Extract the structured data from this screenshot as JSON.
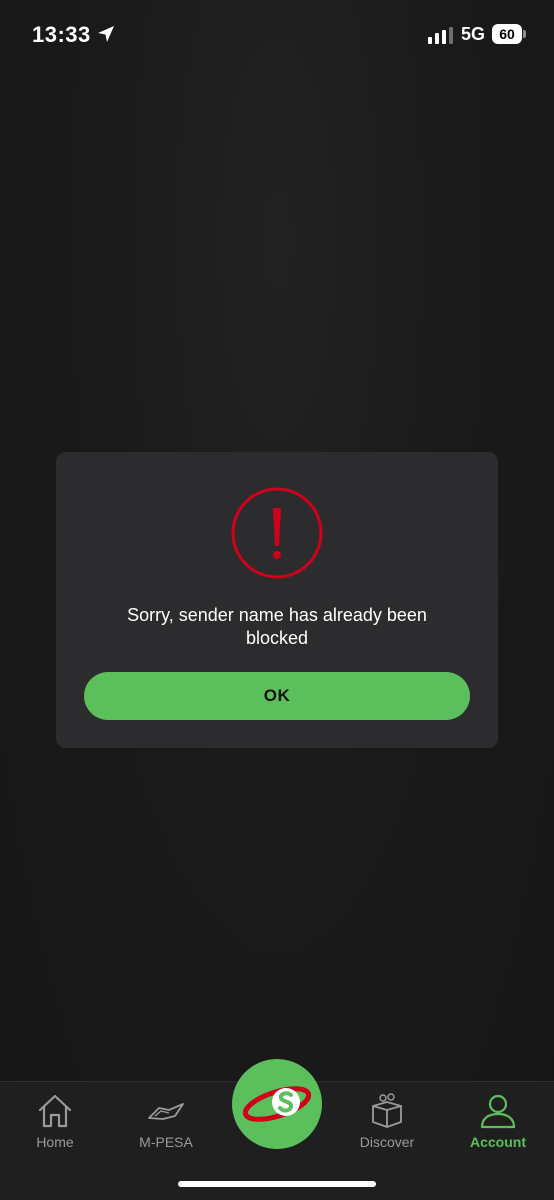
{
  "status_bar": {
    "time": "13:33",
    "network": "5G",
    "battery": "60"
  },
  "dialog": {
    "message": "Sorry, sender name has already been blocked",
    "ok_label": "OK",
    "accent_color": "#d0021b",
    "button_color": "#5bbf5b"
  },
  "nav": {
    "home": "Home",
    "mpesa": "M-PESA",
    "discover": "Discover",
    "account": "Account",
    "active": "account"
  }
}
